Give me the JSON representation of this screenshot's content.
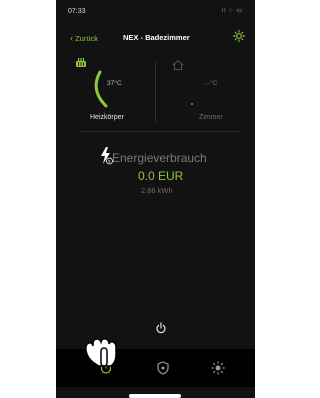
{
  "status": {
    "time": "07:33",
    "icons": "∷ ◌ ▭"
  },
  "nav": {
    "back_label": "Zurück",
    "title": "NEX - Badezimmer"
  },
  "tiles": {
    "heizkoerper": {
      "temp": "37°C",
      "label": "Heizkörper"
    },
    "zimmer": {
      "temp": "-.-°C",
      "label": "Zimmer"
    }
  },
  "energy": {
    "title": "Energieverbrauch",
    "amount": "0.0 EUR",
    "kwh": "2.86 kWh"
  },
  "colors": {
    "accent": "#8cc63f",
    "background": "#121212",
    "tabbar": "#000000"
  },
  "tabs": [
    {
      "icon": "timer-icon"
    },
    {
      "icon": "shield-icon"
    },
    {
      "icon": "sun-icon"
    }
  ]
}
